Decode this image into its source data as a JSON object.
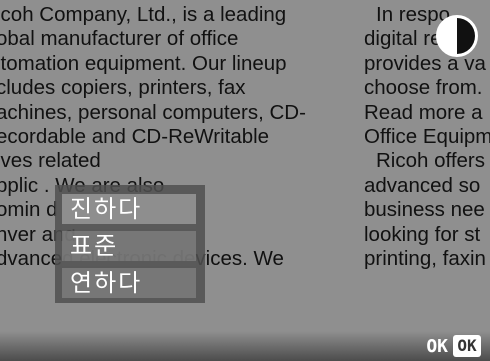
{
  "document": {
    "left_lines": [
      "icoh Company, Ltd., is a leading",
      "obal manufacturer of office",
      "itomation equipment. Our lineup",
      "cludes copiers, printers, fax",
      "achines, personal computers, CD-",
      "ecordable and CD-ReWritable",
      "ives                      related",
      "pplic                    . We are also",
      "omin                    d",
      "nver                     and",
      "dvanced electronic devices. We"
    ],
    "right_lines": [
      "In respo",
      "digital re",
      "provides a va",
      "choose from.",
      "Read more a",
      "Office Equipm",
      "Ricoh offers",
      "advanced so",
      "business nee",
      "looking for st",
      "printing, faxin"
    ]
  },
  "contrast_menu": {
    "items": [
      {
        "label": "진하다",
        "selected": true
      },
      {
        "label": "표준",
        "selected": false
      },
      {
        "label": "연하다",
        "selected": false
      }
    ]
  },
  "footer": {
    "ok_text": "OK",
    "ok_button": "OK"
  },
  "icons": {
    "contrast": "contrast-icon"
  }
}
